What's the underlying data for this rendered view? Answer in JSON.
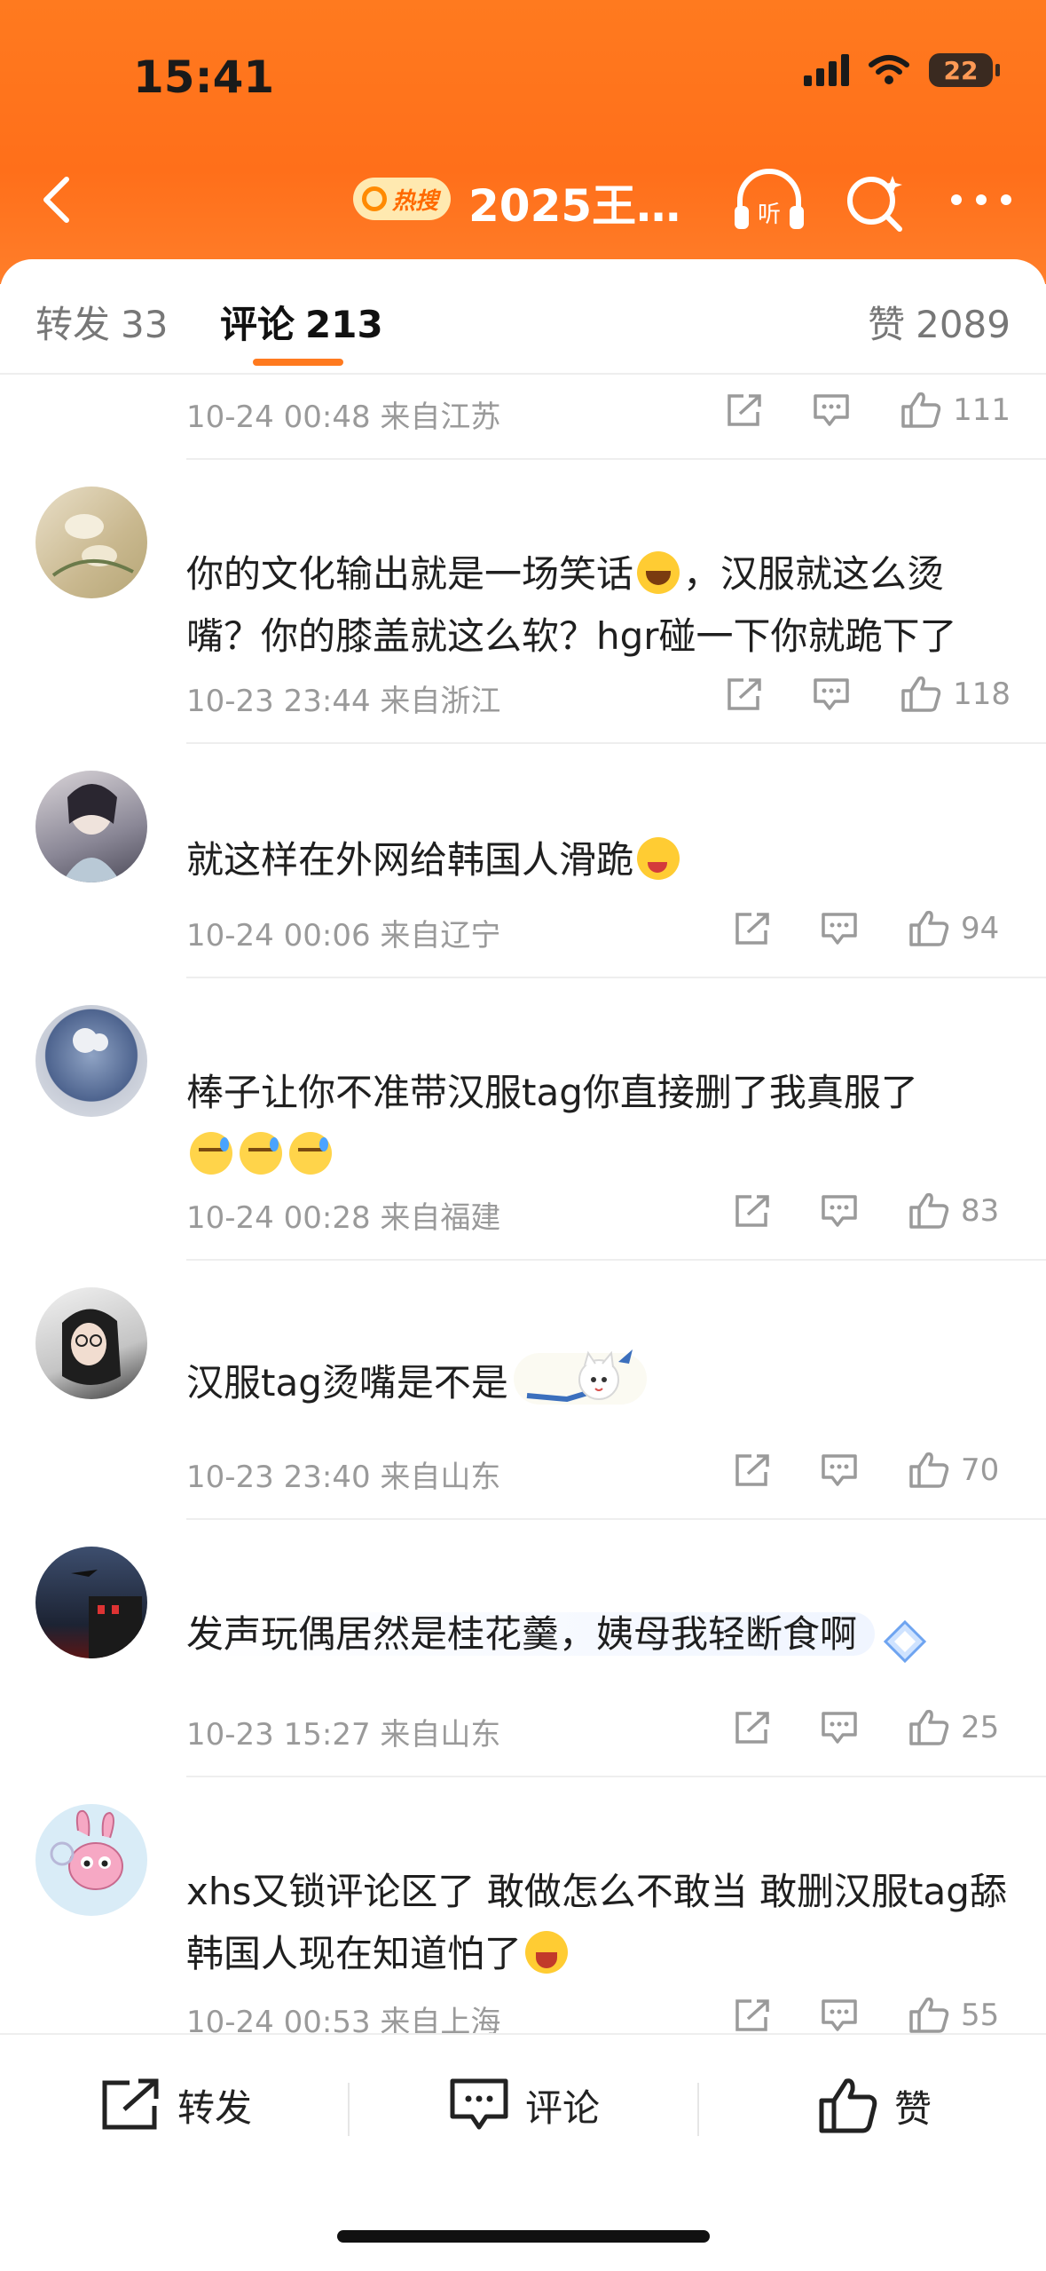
{
  "status_bar": {
    "time": "15:41",
    "battery": "22"
  },
  "header": {
    "hot_badge": "热搜",
    "title": "2025王…"
  },
  "tabs": {
    "repost": {
      "label": "转发",
      "count": "33"
    },
    "comment": {
      "label": "评论",
      "count": "213"
    },
    "like": {
      "label": "赞",
      "count": "2089"
    }
  },
  "comments": [
    {
      "text": "",
      "time": "10-24 00:48",
      "location": "来自江苏",
      "likes": "111"
    },
    {
      "text": "你的文化输出就是一场笑话",
      "text_after": "，汉服就这么烫嘴？你的膝盖就这么软？hgr碰一下你就跪下了",
      "time": "10-23 23:44",
      "location": "来自浙江",
      "likes": "118"
    },
    {
      "text": "就这样在外网给韩国人滑跪",
      "time": "10-24 00:06",
      "location": "来自辽宁",
      "likes": "94"
    },
    {
      "text": "棒子让你不准带汉服tag你直接删了我真服了",
      "time": "10-24 00:28",
      "location": "来自福建",
      "likes": "83"
    },
    {
      "text": "汉服tag烫嘴是不是",
      "time": "10-23 23:40",
      "location": "来自山东",
      "likes": "70"
    },
    {
      "text": "发声玩偶居然是桂花羹，姨母我轻断食啊",
      "time": "10-23 15:27",
      "location": "来自山东",
      "likes": "25"
    },
    {
      "text": "xhs又锁评论区了 敢做怎么不敢当 敢删汉服tag舔韩国人现在知道怕了",
      "time": "10-24 00:53",
      "location": "来自上海",
      "likes": "55"
    }
  ],
  "bottom_bar": {
    "repost": "转发",
    "comment": "评论",
    "like": "赞"
  },
  "colors": {
    "accent": "#ff7a1f",
    "meta_gray": "#9a9a9a"
  }
}
